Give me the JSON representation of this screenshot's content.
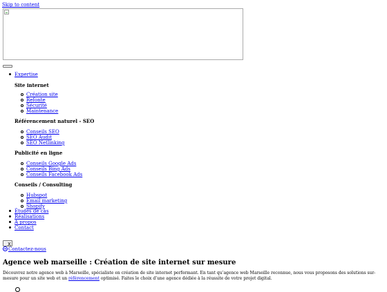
{
  "skip_link": "Skip to content",
  "nav": {
    "expertise": "Expertise",
    "groups": [
      {
        "title": "Site internet",
        "items": [
          "Création site",
          "Refonte",
          "Sécurité",
          "Maintenance"
        ]
      },
      {
        "title": "Référencement naturel - SEO",
        "items": [
          "Conseils SEO",
          "SEO Audit",
          "SEO Netlinking"
        ]
      },
      {
        "title": "Publicité en ligne",
        "items": [
          "Conseils Google Ads",
          "Conseils Bing Ads",
          "Conseils Facebook Ads"
        ]
      },
      {
        "title": "Conseils / Consulting",
        "items": [
          "Hubspot",
          "Email marketing",
          "Shopify"
        ]
      }
    ],
    "main_items": [
      "Études de cas",
      "Réalisations",
      "À propos",
      "Contact"
    ]
  },
  "close_button": "X",
  "contact_link": "Contactez-nous",
  "hero": {
    "title": "Agence web marseille : Création de site internet sur mesure",
    "intro_before": "Découvrez notre agence web à Marseille, spécialiste en création de site internet performant. En tant qu’agence web Marseille reconnue, nous vous proposons des solutions sur-mesure pour un site web et un ",
    "intro_link": "référencement",
    "intro_after": " optimisé. Faites le choix d’une agence dédiée à la réussite de votre projet digital."
  },
  "colors": {
    "link": "#0000ee",
    "text": "#000000",
    "background": "#ffffff"
  },
  "icons": {
    "logo": "broken-image-icon",
    "menu": "menu-toggle-icon",
    "contact": "contact-circle-icon",
    "close": "close-icon"
  }
}
